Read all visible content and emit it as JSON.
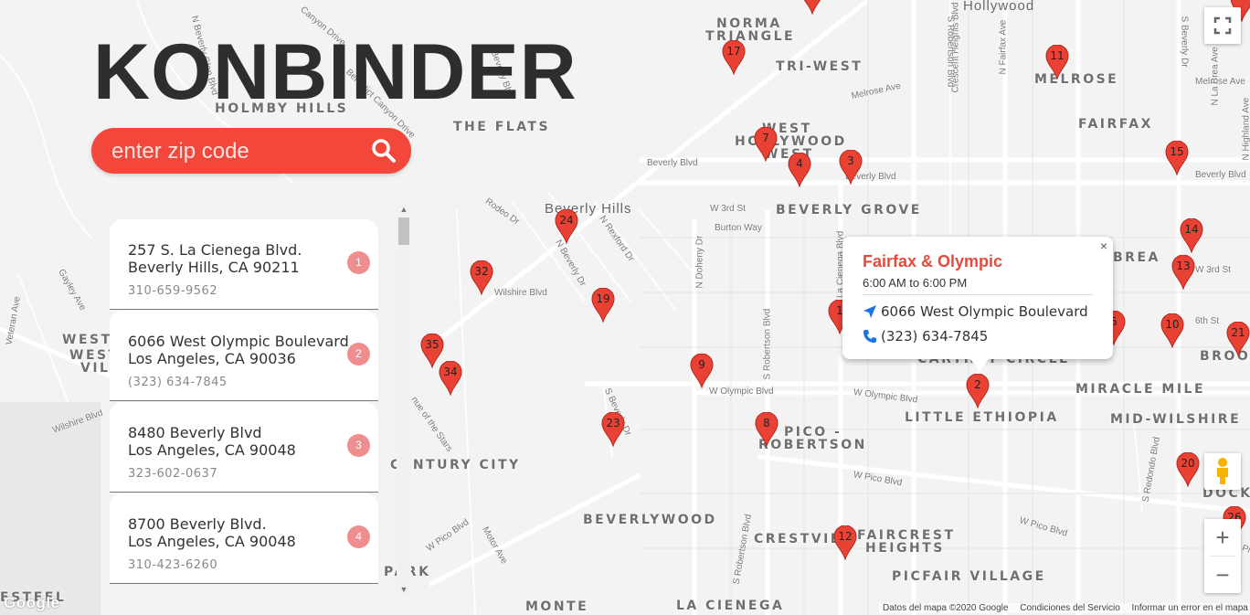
{
  "brand": "KONBINDER",
  "search": {
    "placeholder": "enter zip code"
  },
  "neighborhoods": [
    {
      "label": "NORMA"
    },
    {
      "label": "TRIANGLE"
    },
    {
      "label": "TRI-WEST"
    },
    {
      "label": "MELROSE"
    },
    {
      "label": "HOLMBY HILLS"
    },
    {
      "label": "THE FLATS"
    },
    {
      "label": "FAIRFAX"
    },
    {
      "label": "WEST"
    },
    {
      "label": "HOLLYWOOD"
    },
    {
      "label": "WEST"
    },
    {
      "label": "BEVERLY GROVE"
    },
    {
      "label": "BREA"
    },
    {
      "label": "CARTHAY CIRCLE"
    },
    {
      "label": "MIRACLE MILE"
    },
    {
      "label": "LITTLE ETHIOPIA"
    },
    {
      "label": "MID-WILSHIRE"
    },
    {
      "label": "PICO -"
    },
    {
      "label": "ROBERTSON"
    },
    {
      "label": "CENTURY CITY"
    },
    {
      "label": "BEVERLYWOOD"
    },
    {
      "label": "CRESTVIEW"
    },
    {
      "label": "FAIRCREST"
    },
    {
      "label": "HEIGHTS"
    },
    {
      "label": "PICFAIR VILLAGE"
    },
    {
      "label": "DOCKW"
    },
    {
      "label": "BROOK"
    },
    {
      "label": "MONTE"
    },
    {
      "label": "LA CIENEGA"
    },
    {
      "label": "WESTW"
    },
    {
      "label": "WEST"
    },
    {
      "label": "VILL"
    },
    {
      "label": "ESTEEL"
    },
    {
      "label": "PARK"
    }
  ],
  "cities": [
    {
      "label": "Beverly Hills"
    },
    {
      "label": "Hollywood"
    }
  ],
  "streets": [
    {
      "label": "Beverly Blvd"
    },
    {
      "label": "Beverly Blvd"
    },
    {
      "label": "Beverly Blvd"
    },
    {
      "label": "W 3rd St"
    },
    {
      "label": "Burton Way"
    },
    {
      "label": "Wilshire Blvd"
    },
    {
      "label": "W Olympic Blvd"
    },
    {
      "label": "W Olympic Blvd"
    },
    {
      "label": "W Pico Blvd"
    },
    {
      "label": "W Pico Blvd"
    },
    {
      "label": "W Pico Blvd"
    },
    {
      "label": "Melrose Ave"
    },
    {
      "label": "Melrose Ave"
    },
    {
      "label": "S Robertson Blvd"
    },
    {
      "label": "S Robertson Blvd"
    },
    {
      "label": "N Doheny Dr"
    },
    {
      "label": "N Rexford Dr"
    },
    {
      "label": "Rodeo Dr"
    },
    {
      "label": "N Beverly Dr"
    },
    {
      "label": "S Beverly Dr"
    },
    {
      "label": "Crescent Heights Blvd"
    },
    {
      "label": "N Fairfax Ave"
    },
    {
      "label": "N La Brea Ave"
    },
    {
      "label": "N Highland Ave"
    },
    {
      "label": "S Redondo Blvd"
    },
    {
      "label": "Motor Ave"
    },
    {
      "label": "Veteran Ave"
    },
    {
      "label": "Gayley Ave"
    },
    {
      "label": "Wilshire Blvd"
    },
    {
      "label": "Benedict Canyon Drive"
    },
    {
      "label": "Canyon Drive"
    },
    {
      "label": "N Beverly Glen Blvd"
    },
    {
      "label": "W 3rd St"
    },
    {
      "label": "6th St"
    },
    {
      "label": "S La Cienega Blvd"
    },
    {
      "label": "nue of the Stars"
    },
    {
      "label": "Beverly Blvd"
    },
    {
      "label": "W Pico Blvd"
    },
    {
      "label": "S Beverly Dr"
    },
    {
      "label": "S Robertson Blvd"
    }
  ],
  "markers": [
    {
      "n": "17"
    },
    {
      "n": "11"
    },
    {
      "n": "7"
    },
    {
      "n": "4"
    },
    {
      "n": "3"
    },
    {
      "n": "15"
    },
    {
      "n": "24"
    },
    {
      "n": "32"
    },
    {
      "n": "19"
    },
    {
      "n": "14"
    },
    {
      "n": "13"
    },
    {
      "n": "10"
    },
    {
      "n": "21"
    },
    {
      "n": "35"
    },
    {
      "n": "34"
    },
    {
      "n": "9"
    },
    {
      "n": "2"
    },
    {
      "n": "23"
    },
    {
      "n": "8"
    },
    {
      "n": "20"
    },
    {
      "n": "26"
    },
    {
      "n": "12"
    },
    {
      "n": "5"
    },
    {
      "n": "1"
    },
    {
      "n": ""
    },
    {
      "n": ""
    }
  ],
  "stores": [
    {
      "line1": "257 S. La Cienega Blvd.",
      "line2": "Beverly Hills, CA 90211",
      "phone": "310-659-9562",
      "num": "1"
    },
    {
      "line1": "6066 West Olympic Boulevard",
      "line2": "Los Angeles, CA 90036",
      "phone": "(323) 634-7845",
      "num": "2"
    },
    {
      "line1": "8480 Beverly Blvd",
      "line2": "Los Angeles, CA 90048",
      "phone": "323-602-0637",
      "num": "3"
    },
    {
      "line1": "8700 Beverly Blvd.",
      "line2": "Los Angeles, CA 90048",
      "phone": "310-423-6260",
      "num": "4"
    }
  ],
  "infowindow": {
    "title": "Fairfax & Olympic",
    "hours": "6:00 AM to 6:00 PM",
    "address": "6066 West Olympic Boulevard",
    "phone": "(323) 634-7845",
    "close": "×"
  },
  "controls": {
    "zoom_in": "+",
    "zoom_out": "−"
  },
  "attribution": {
    "map_data": "Datos del mapa ©2020 Google",
    "terms": "Condiciones del Servicio",
    "report": "Informar un error en el mapa",
    "logo": "Google"
  },
  "colors": {
    "accent": "#f2473a",
    "marker": "#e94235",
    "badge": "#ef8e8e"
  }
}
